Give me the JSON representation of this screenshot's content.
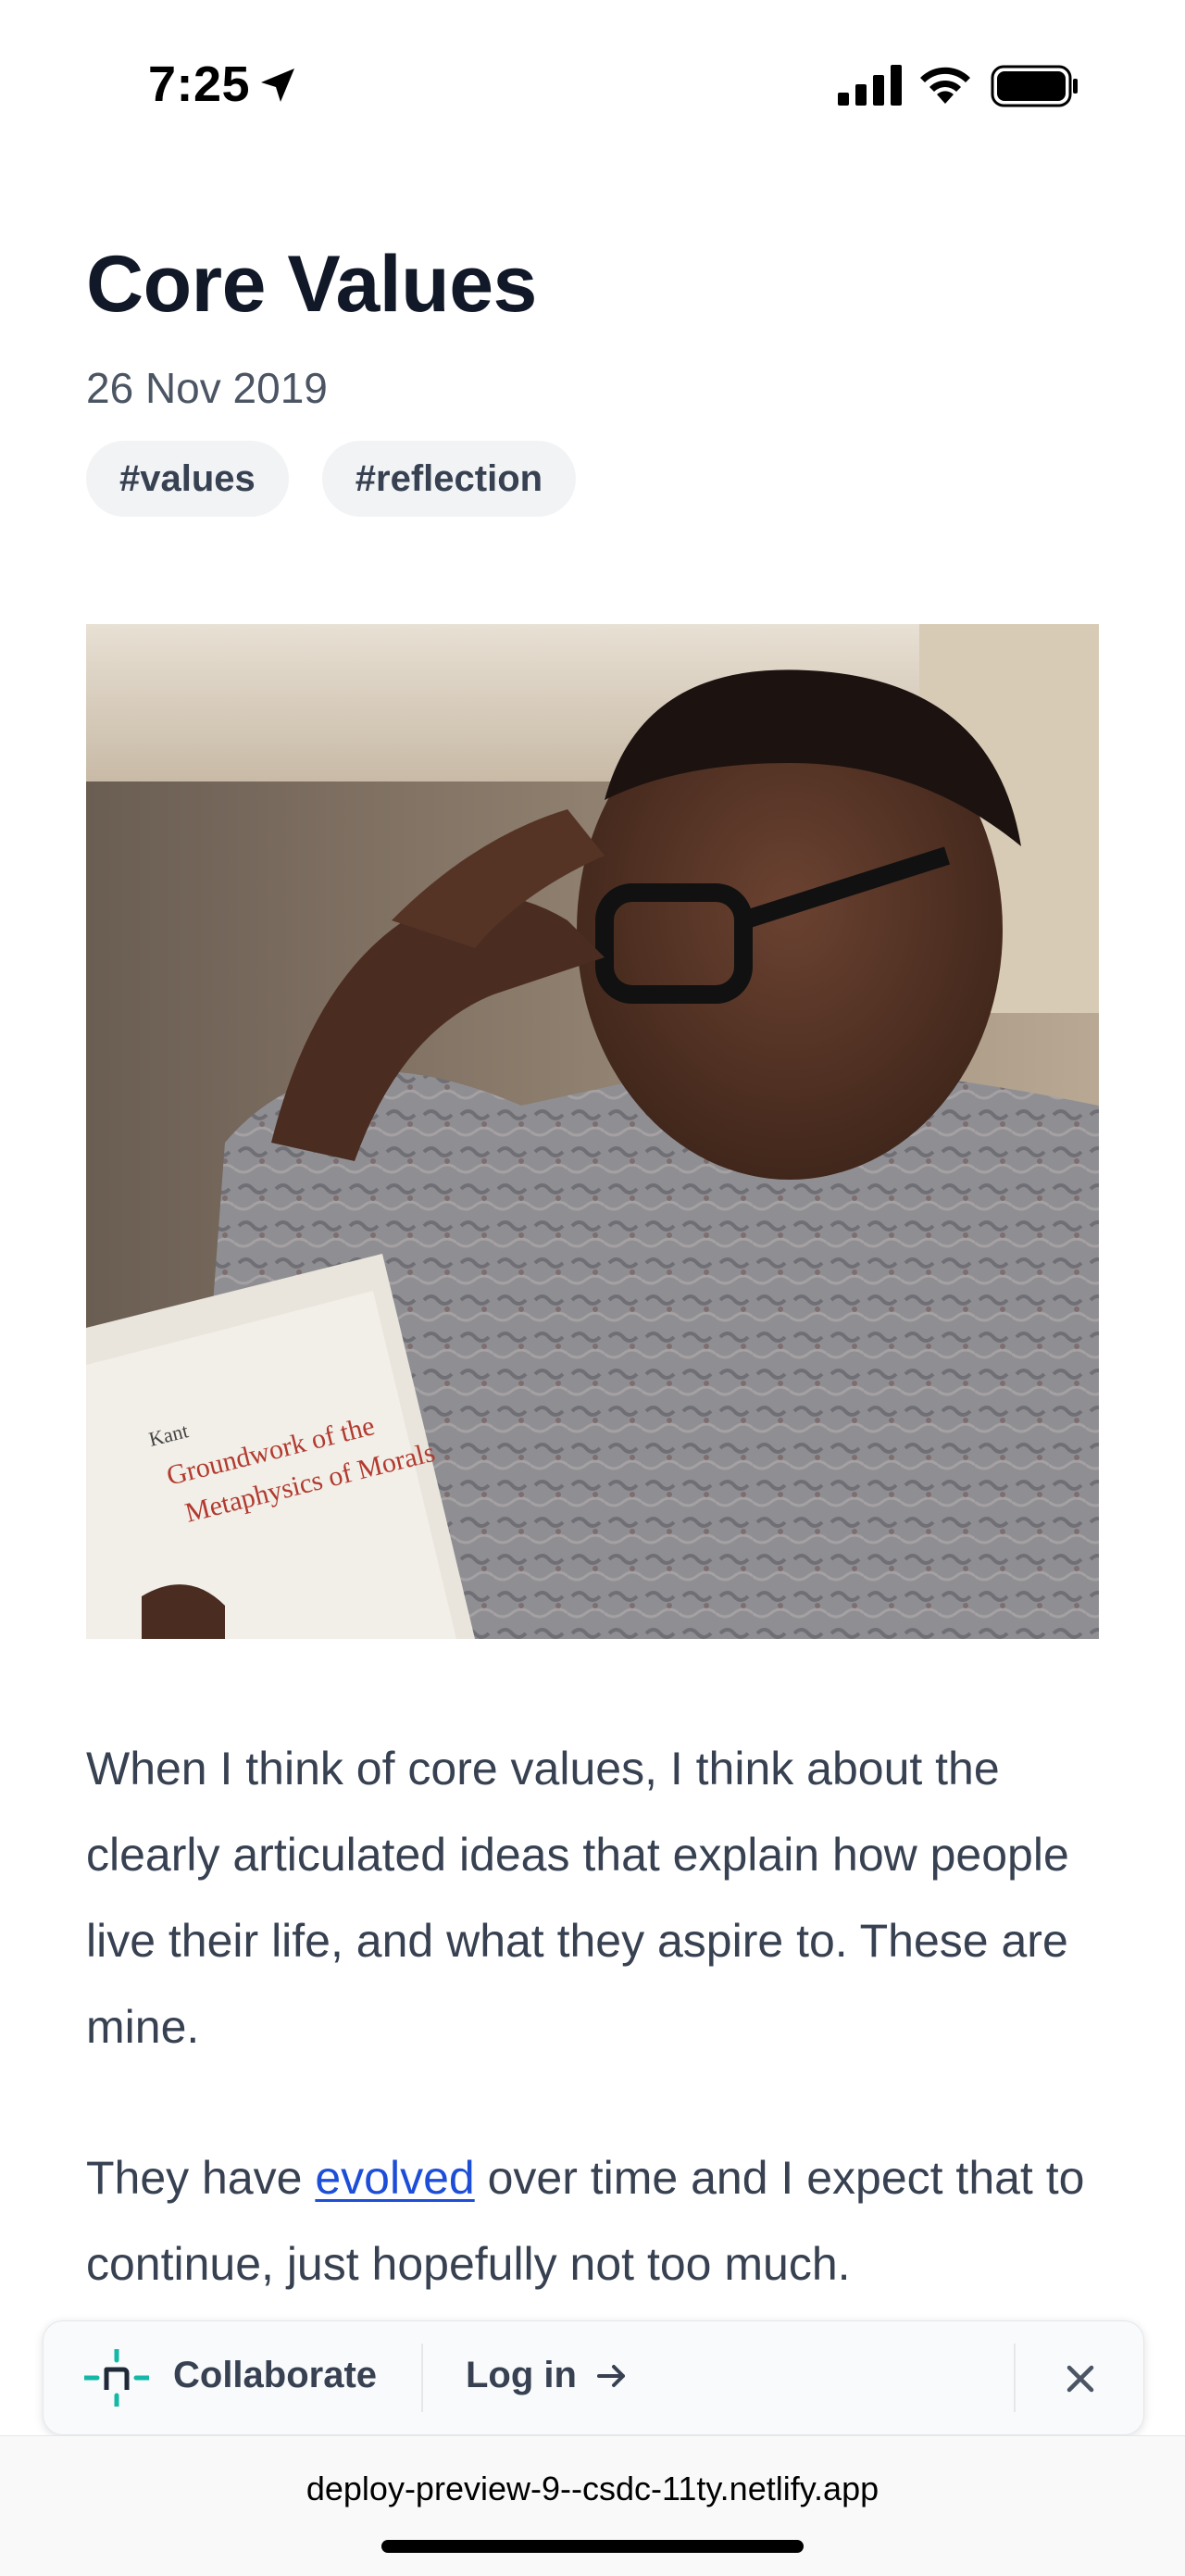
{
  "status_bar": {
    "time": "7:25",
    "icons": [
      "location-arrow-icon",
      "cellular-signal-icon",
      "wifi-icon",
      "battery-icon"
    ]
  },
  "article": {
    "title": "Core Values",
    "date": "26 Nov 2019",
    "tags": [
      "#values",
      "#reflection"
    ],
    "hero_image": "man-reading-book-photo",
    "paragraph1": "When I think of core values, I think about the clearly articulated ideas that explain how people live their life, and what they aspire to. These are mine.",
    "paragraph2_before": "They have ",
    "paragraph2_link": "evolved",
    "paragraph2_after": " over time and I expect that to continue, just hopefully not too much."
  },
  "collab_bar": {
    "collaborate_label": "Collaborate",
    "login_label": "Log in",
    "icons": [
      "netlify-logo-icon",
      "arrow-right-icon",
      "close-icon"
    ]
  },
  "browser": {
    "url": "deploy-preview-9--csdc-11ty.netlify.app"
  },
  "colors": {
    "text_primary": "#111827",
    "text_body": "#374151",
    "link": "#1d4ed8",
    "tag_bg": "#f1f3f5",
    "brand_teal": "#14b8a6"
  }
}
